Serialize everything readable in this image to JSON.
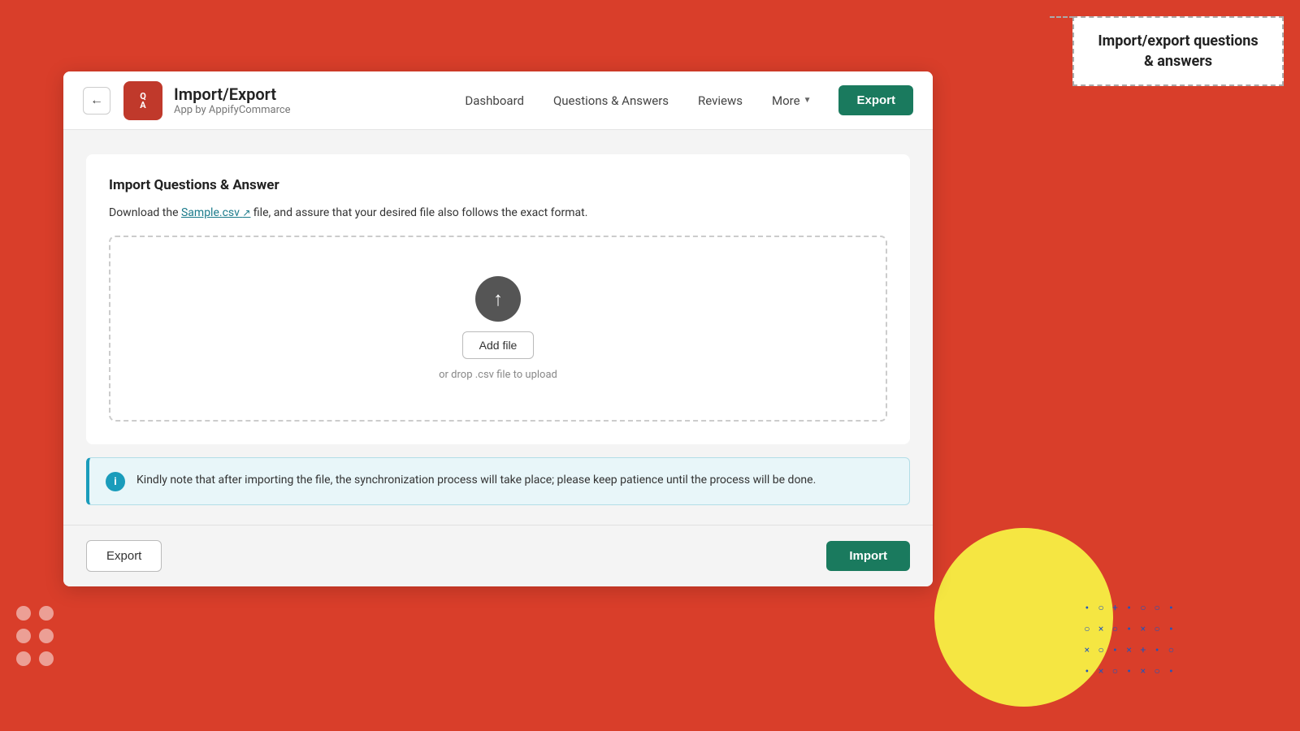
{
  "annotation": {
    "title": "Import/export\nquestions & answers"
  },
  "header": {
    "back_button_label": "←",
    "logo_text_top": "Q",
    "logo_text_bottom": "A",
    "app_title": "Import/Export",
    "app_subtitle": "App by AppifyCommarce",
    "nav_items": [
      {
        "label": "Dashboard",
        "id": "dashboard"
      },
      {
        "label": "Questions & Answers",
        "id": "questions-answers"
      },
      {
        "label": "Reviews",
        "id": "reviews"
      },
      {
        "label": "More",
        "id": "more",
        "has_dropdown": true
      }
    ],
    "export_button": "Export"
  },
  "main": {
    "import_card": {
      "title": "Import Questions & Answer",
      "description_prefix": "Download the ",
      "sample_link_text": "Sample.csv",
      "description_suffix": " file, and assure that your desired file also follows the exact format.",
      "dropzone": {
        "add_file_button": "Add file",
        "drop_hint": "or drop .csv file to upload"
      },
      "info_banner": {
        "icon_text": "i",
        "message": "Kindly note that after importing the file, the synchronization process will take place; please keep patience until the process will be done."
      }
    }
  },
  "footer": {
    "export_button": "Export",
    "import_button": "Import"
  },
  "decorative": {
    "dot_symbols": [
      "•",
      "○",
      "+",
      "•",
      "○",
      "○",
      "•",
      "×",
      "○",
      "•",
      "×",
      "○",
      "•",
      "×",
      "○",
      "•",
      "×",
      "+",
      "•",
      "○",
      "•",
      "×",
      "○",
      "•",
      "×",
      "○",
      "•"
    ]
  }
}
